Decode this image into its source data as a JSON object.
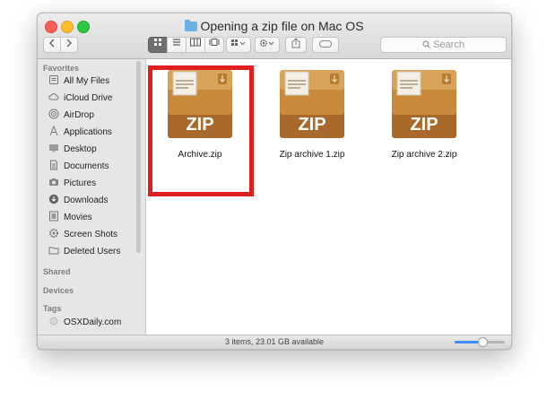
{
  "window": {
    "title": "Opening a zip file on Mac OS",
    "folder_icon": "folder-icon"
  },
  "toolbar": {
    "back_icon": "chevron-left-icon",
    "forward_icon": "chevron-right-icon",
    "views": [
      {
        "name": "icon-view",
        "glyph": "⊞",
        "active": true
      },
      {
        "name": "list-view",
        "glyph": "≡",
        "active": false
      },
      {
        "name": "column-view",
        "glyph": "▥",
        "active": false
      },
      {
        "name": "gallery-view",
        "glyph": "⊡",
        "active": false
      }
    ],
    "arrange_icon": "arrange-icon",
    "action_icon": "gear-icon",
    "share_icon": "share-icon",
    "tag_icon": "tag-icon",
    "search_placeholder": "Search"
  },
  "sidebar": {
    "favorites_header": "Favorites",
    "favorites": [
      {
        "label": "All My Files",
        "icon": "all-files-icon"
      },
      {
        "label": "iCloud Drive",
        "icon": "cloud-icon"
      },
      {
        "label": "AirDrop",
        "icon": "airdrop-icon"
      },
      {
        "label": "Applications",
        "icon": "applications-icon"
      },
      {
        "label": "Desktop",
        "icon": "desktop-icon"
      },
      {
        "label": "Documents",
        "icon": "document-icon"
      },
      {
        "label": "Pictures",
        "icon": "camera-icon"
      },
      {
        "label": "Downloads",
        "icon": "download-icon"
      },
      {
        "label": "Movies",
        "icon": "film-icon"
      },
      {
        "label": "Screen Shots",
        "icon": "gear-icon"
      },
      {
        "label": "Deleted Users",
        "icon": "folder-icon"
      }
    ],
    "shared_header": "Shared",
    "devices_header": "Devices",
    "tags_header": "Tags",
    "tags": [
      {
        "label": "OSXDaily.com",
        "color": "#d6d6d6"
      }
    ]
  },
  "files": [
    {
      "name": "Archive.zip",
      "badge": "ZIP",
      "highlighted": true
    },
    {
      "name": "Zip archive 1.zip",
      "badge": "ZIP",
      "highlighted": false
    },
    {
      "name": "Zip archive 2.zip",
      "badge": "ZIP",
      "highlighted": false
    }
  ],
  "status": {
    "text": "3 items, 23.01 GB available",
    "zoom_level": 0.55
  },
  "colors": {
    "highlight": "#e02020",
    "zip_body": "#c98a3c",
    "zip_dark": "#a8692a",
    "zip_badge_text": "#ffffff"
  }
}
